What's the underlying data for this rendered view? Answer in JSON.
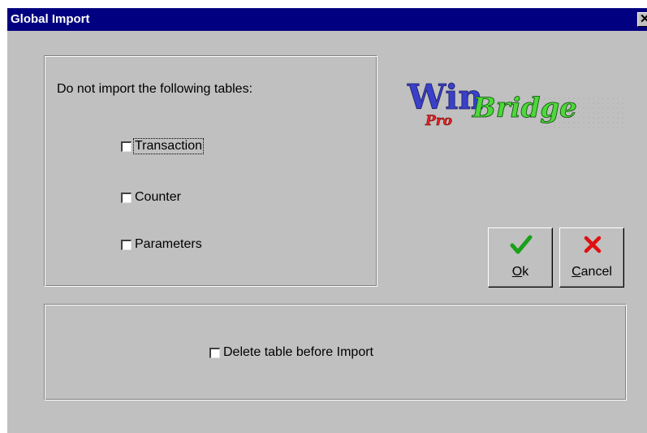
{
  "window": {
    "title": "Global Import",
    "close_glyph": "✕"
  },
  "exclude_group": {
    "heading": "Do not import the following tables:",
    "options": [
      {
        "label": "Transaction",
        "checked": false
      },
      {
        "label": "Counter",
        "checked": false
      },
      {
        "label": "Parameters",
        "checked": false
      }
    ]
  },
  "logo": {
    "win": "Win",
    "pro": "Pro",
    "bridge": "Bridge"
  },
  "buttons": {
    "ok": {
      "mnemonic": "O",
      "rest": "k",
      "icon": "checkmark-icon",
      "color": "#1aa01a"
    },
    "cancel": {
      "mnemonic": "C",
      "rest": "ancel",
      "icon": "x-icon",
      "color": "#e01010"
    }
  },
  "delete_group": {
    "option_label": "Delete table before Import",
    "checked": false
  }
}
